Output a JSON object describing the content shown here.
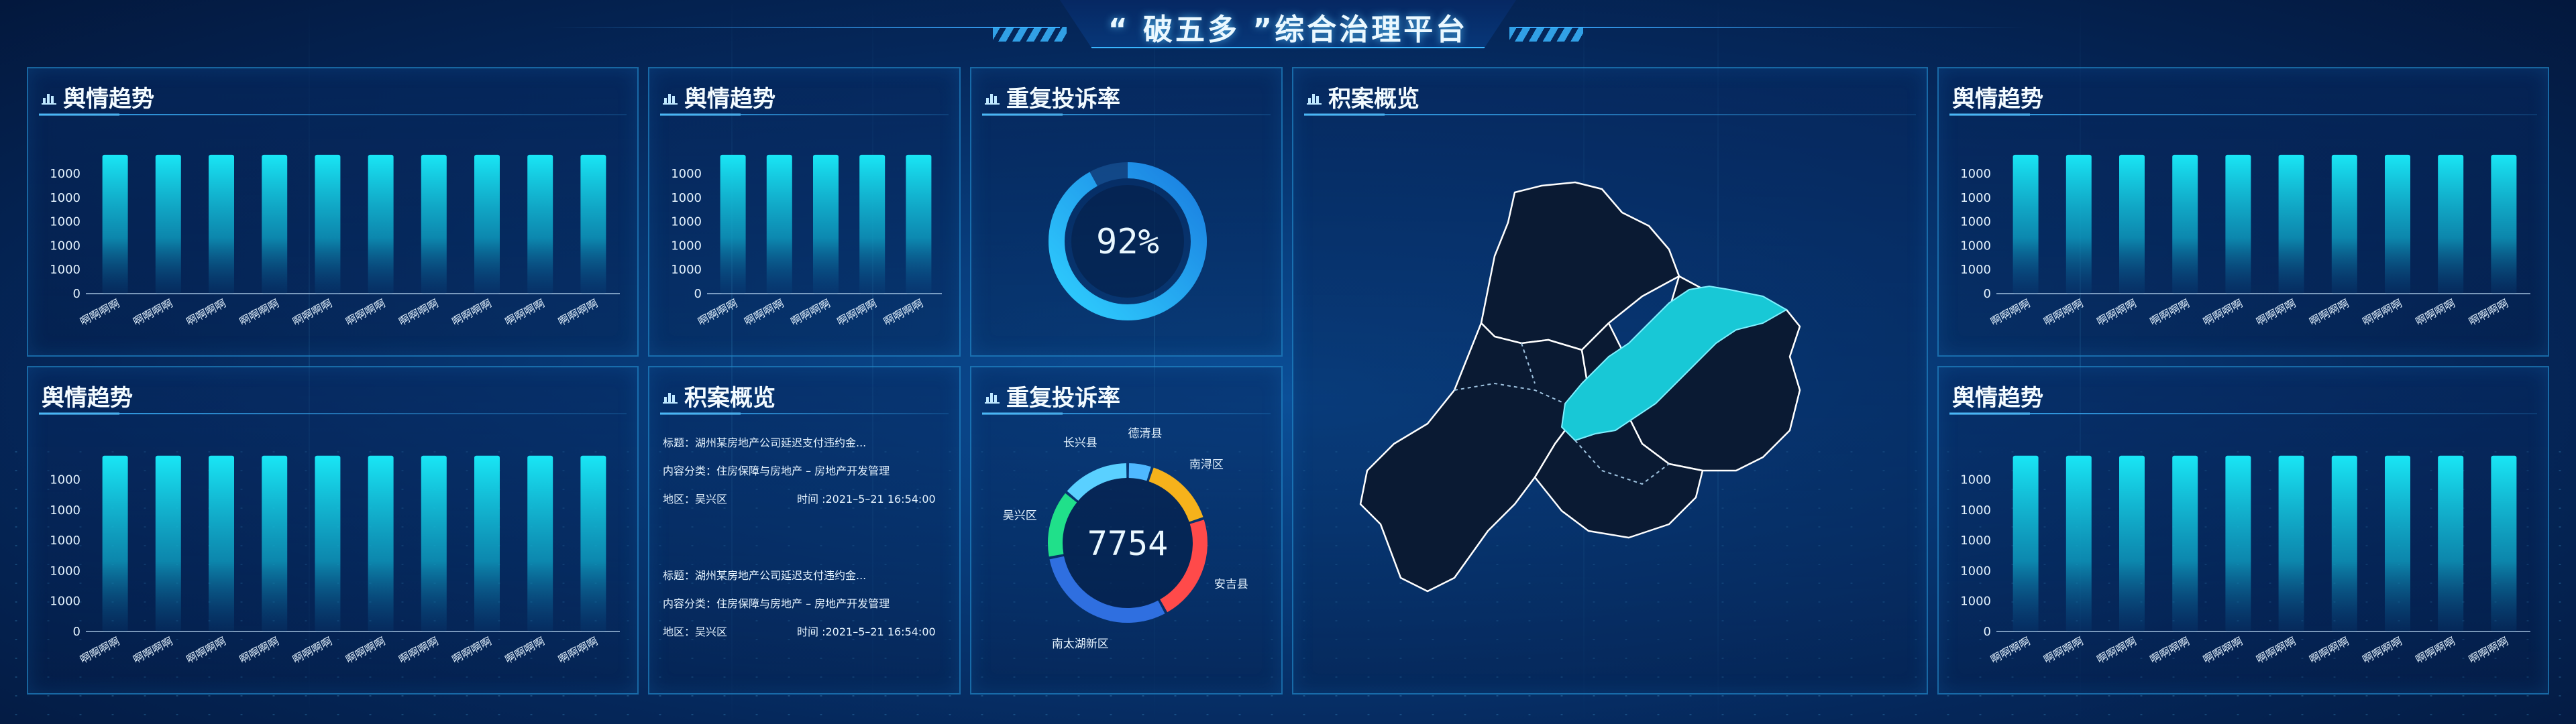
{
  "header": {
    "title": "“ 破五多 ”综合治理平台"
  },
  "panels": {
    "trend_1": {
      "title": "舆情趋势"
    },
    "trend_2": {
      "title": "舆情趋势"
    },
    "trend_3": {
      "title": "舆情趋势"
    },
    "trend_4": {
      "title": "舆情趋势"
    },
    "trend_5": {
      "title": "舆情趋势"
    },
    "repeat_1": {
      "title": "重复投诉率",
      "value": "92%",
      "percent": 92
    },
    "repeat_2": {
      "title": "重复投诉率",
      "value": "7754",
      "regions": [
        "德清县",
        "南浔区",
        "安吉县",
        "南太湖新区",
        "吴兴区",
        "长兴县"
      ]
    },
    "backlog_list": {
      "title": "积案概览",
      "items": [
        {
          "title": "标题：湖州某房地产公司延迟支付违约金...",
          "category": "内容分类：住房保障与房地产 – 房地产开发管理",
          "region": "地区：吴兴区",
          "time": "时间 :2021–5–21 16:54:00"
        },
        {
          "title": "标题：湖州某房地产公司延迟支付违约金...",
          "category": "内容分类：住房保障与房地产 – 房地产开发管理",
          "region": "地区：吴兴区",
          "time": "时间 :2021–5–21 16:54:00"
        }
      ]
    },
    "backlog_map": {
      "title": "积案概览"
    }
  },
  "colors": {
    "accent": "#39b6ff",
    "bar_top": "#19e6f5",
    "donut": [
      "#4fb8ff",
      "#f6b21b",
      "#ff4a4a",
      "#2f6fe0",
      "#20e08a",
      "#5ad0ff"
    ],
    "map_highlight": "#18c8d6",
    "map_fill": "#0a1a33"
  },
  "chart_data": [
    {
      "type": "bar",
      "title": "舆情趋势",
      "categories": [
        "啊啊啊啊",
        "啊啊啊啊",
        "啊啊啊啊",
        "啊啊啊啊",
        "啊啊啊啊",
        "啊啊啊啊",
        "啊啊啊啊",
        "啊啊啊啊",
        "啊啊啊啊",
        "啊啊啊啊"
      ],
      "values": [
        1000,
        1000,
        1000,
        1000,
        1000,
        1000,
        1000,
        1000,
        1000,
        1000
      ],
      "yticks": [
        "0",
        "1000",
        "1000",
        "1000",
        "1000",
        "1000"
      ],
      "ylim": [
        0,
        1000
      ]
    },
    {
      "type": "bar",
      "title": "舆情趋势",
      "categories": [
        "啊啊啊啊",
        "啊啊啊啊",
        "啊啊啊啊",
        "啊啊啊啊",
        "啊啊啊啊"
      ],
      "values": [
        1000,
        1000,
        1000,
        1000,
        1000
      ],
      "yticks": [
        "0",
        "1000",
        "1000",
        "1000",
        "1000",
        "1000"
      ],
      "ylim": [
        0,
        1000
      ]
    },
    {
      "type": "bar",
      "title": "舆情趋势",
      "categories": [
        "啊啊啊啊",
        "啊啊啊啊",
        "啊啊啊啊",
        "啊啊啊啊",
        "啊啊啊啊",
        "啊啊啊啊",
        "啊啊啊啊",
        "啊啊啊啊",
        "啊啊啊啊",
        "啊啊啊啊"
      ],
      "values": [
        1000,
        1000,
        1000,
        1000,
        1000,
        1000,
        1000,
        1000,
        1000,
        1000
      ],
      "yticks": [
        "0",
        "1000",
        "1000",
        "1000",
        "1000",
        "1000"
      ],
      "ylim": [
        0,
        1000
      ]
    },
    {
      "type": "bar",
      "title": "舆情趋势",
      "categories": [
        "啊啊啊啊",
        "啊啊啊啊",
        "啊啊啊啊",
        "啊啊啊啊",
        "啊啊啊啊",
        "啊啊啊啊",
        "啊啊啊啊",
        "啊啊啊啊",
        "啊啊啊啊",
        "啊啊啊啊"
      ],
      "values": [
        1000,
        1000,
        1000,
        1000,
        1000,
        1000,
        1000,
        1000,
        1000,
        1000
      ],
      "yticks": [
        "0",
        "1000",
        "1000",
        "1000",
        "1000",
        "1000"
      ],
      "ylim": [
        0,
        1000
      ]
    },
    {
      "type": "bar",
      "title": "舆情趋势",
      "categories": [
        "啊啊啊啊",
        "啊啊啊啊",
        "啊啊啊啊",
        "啊啊啊啊",
        "啊啊啊啊",
        "啊啊啊啊",
        "啊啊啊啊",
        "啊啊啊啊",
        "啊啊啊啊",
        "啊啊啊啊"
      ],
      "values": [
        1000,
        1000,
        1000,
        1000,
        1000,
        1000,
        1000,
        1000,
        1000,
        1000
      ],
      "yticks": [
        "0",
        "1000",
        "1000",
        "1000",
        "1000",
        "1000"
      ],
      "ylim": [
        0,
        1000
      ]
    },
    {
      "type": "pie",
      "title": "重复投诉率",
      "categories": [
        "德清县",
        "南浔区",
        "安吉县",
        "南太湖新区",
        "吴兴区",
        "长兴县"
      ],
      "values": [
        5,
        15,
        22,
        30,
        14,
        14
      ],
      "center_label": "7754"
    }
  ]
}
